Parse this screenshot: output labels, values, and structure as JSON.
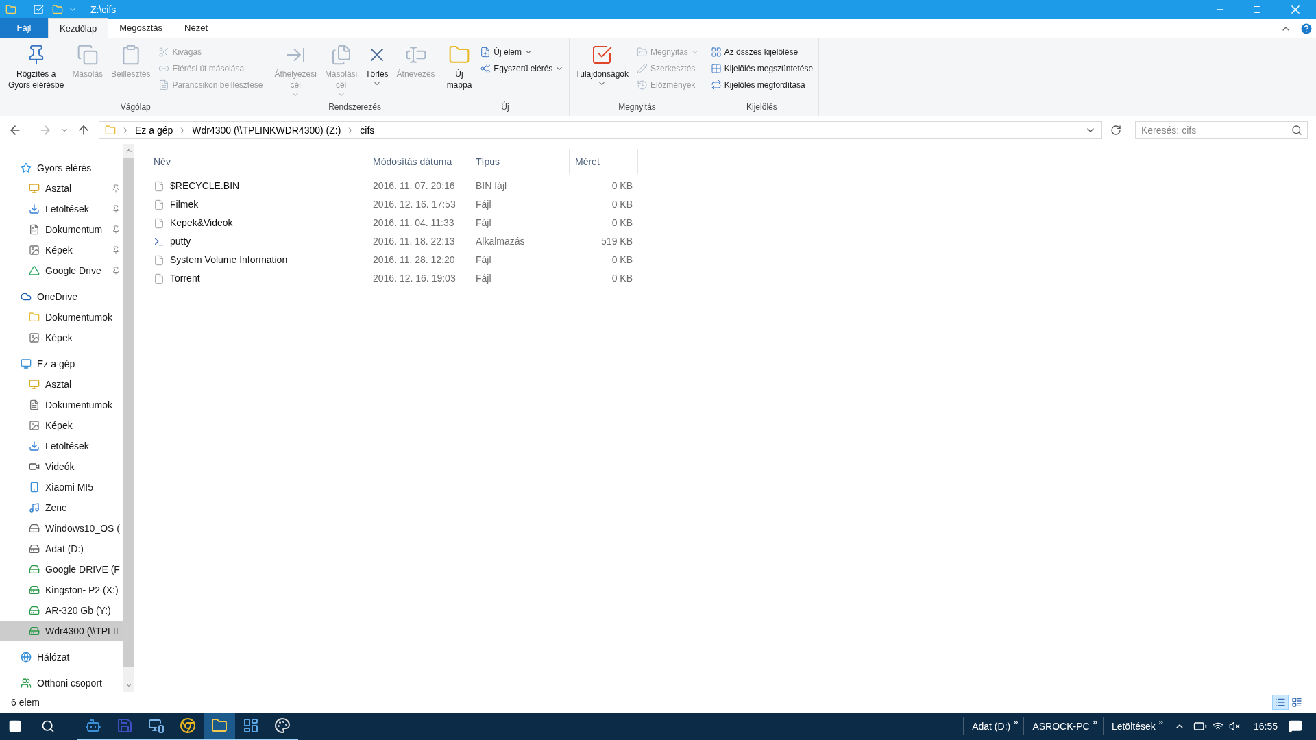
{
  "window": {
    "title": "Z:\\cifs"
  },
  "ribbon_tabs": [
    {
      "label": "Fájl",
      "kind": "file",
      "selected": false
    },
    {
      "label": "Kezdőlap",
      "kind": "tab",
      "selected": true
    },
    {
      "label": "Megosztás",
      "kind": "tab",
      "selected": false
    },
    {
      "label": "Nézet",
      "kind": "tab",
      "selected": false
    }
  ],
  "ribbon_groups": [
    {
      "label": "Vágólap",
      "commands": [
        {
          "label": "Rögzítés a\nGyors elérésbe",
          "kind": "large",
          "disabled": false,
          "dropdown": false
        },
        {
          "label": "Másolás",
          "kind": "large",
          "disabled": true,
          "dropdown": false
        },
        {
          "label": "Beillesztés",
          "kind": "large",
          "disabled": true,
          "dropdown": false
        },
        {
          "label": "Kivágás",
          "kind": "small",
          "disabled": true,
          "dropdown": false
        },
        {
          "label": "Elérési út másolása",
          "kind": "small",
          "disabled": true,
          "dropdown": false
        },
        {
          "label": "Parancsikon beillesztése",
          "kind": "small",
          "disabled": true,
          "dropdown": false
        }
      ]
    },
    {
      "label": "Rendszerezés",
      "commands": [
        {
          "label": "Áthelyezési\ncél",
          "kind": "large",
          "disabled": true,
          "dropdown": true
        },
        {
          "label": "Másolási\ncél",
          "kind": "large",
          "disabled": true,
          "dropdown": true
        },
        {
          "label": "Törlés",
          "kind": "large",
          "disabled": false,
          "dropdown": true
        },
        {
          "label": "Átnevezés",
          "kind": "large",
          "disabled": true,
          "dropdown": false
        }
      ]
    },
    {
      "label": "Új",
      "commands": [
        {
          "label": "Új\nmappa",
          "kind": "large",
          "disabled": false,
          "dropdown": false
        },
        {
          "label": "Új elem",
          "kind": "small",
          "disabled": false,
          "dropdown": true
        },
        {
          "label": "Egyszerű elérés",
          "kind": "small",
          "disabled": false,
          "dropdown": true
        }
      ]
    },
    {
      "label": "Megnyitás",
      "commands": [
        {
          "label": "Tulajdonságok",
          "kind": "large",
          "disabled": false,
          "dropdown": true
        },
        {
          "label": "Megnyitás",
          "kind": "small",
          "disabled": true,
          "dropdown": true
        },
        {
          "label": "Szerkesztés",
          "kind": "small",
          "disabled": true,
          "dropdown": false
        },
        {
          "label": "Előzmények",
          "kind": "small",
          "disabled": true,
          "dropdown": false
        }
      ]
    },
    {
      "label": "Kijelölés",
      "commands": [
        {
          "label": "Az összes kijelölése",
          "kind": "small",
          "disabled": false,
          "dropdown": false
        },
        {
          "label": "Kijelölés megszüntetése",
          "kind": "small",
          "disabled": false,
          "dropdown": false
        },
        {
          "label": "Kijelölés megfordítása",
          "kind": "small",
          "disabled": false,
          "dropdown": false
        }
      ]
    }
  ],
  "address_bar": {
    "crumbs": [
      "Ez a gép",
      "Wdr4300 (\\\\TPLINKWDR4300) (Z:)",
      "cifs"
    ]
  },
  "search": {
    "placeholder": "Keresés: cifs"
  },
  "nav_pane": {
    "items": [
      {
        "label": "Gyors elérés",
        "kind": "quick",
        "selected": false,
        "children": [
          {
            "label": "Asztal",
            "kind": "desktop",
            "pinned": true,
            "selected": false
          },
          {
            "label": "Letöltések",
            "kind": "downloads",
            "pinned": true,
            "selected": false
          },
          {
            "label": "Dokumentum",
            "kind": "documents",
            "pinned": true,
            "selected": false
          },
          {
            "label": "Képek",
            "kind": "pictures",
            "pinned": true,
            "selected": false
          },
          {
            "label": "Google Drive",
            "kind": "gdrive",
            "pinned": true,
            "selected": false
          }
        ]
      },
      {
        "label": "OneDrive",
        "kind": "cloud",
        "selected": false,
        "children": [
          {
            "label": "Dokumentumok",
            "kind": "folder",
            "pinned": false,
            "selected": false
          },
          {
            "label": "Képek",
            "kind": "pictures",
            "pinned": false,
            "selected": false
          }
        ]
      },
      {
        "label": "Ez a gép",
        "kind": "pc",
        "selected": false,
        "children": [
          {
            "label": "Asztal",
            "kind": "desktop",
            "pinned": false,
            "selected": false
          },
          {
            "label": "Dokumentumok",
            "kind": "documents",
            "pinned": false,
            "selected": false
          },
          {
            "label": "Képek",
            "kind": "pictures",
            "pinned": false,
            "selected": false
          },
          {
            "label": "Letöltések",
            "kind": "downloads",
            "pinned": false,
            "selected": false
          },
          {
            "label": "Videók",
            "kind": "videos",
            "pinned": false,
            "selected": false
          },
          {
            "label": "Xiaomi MI5",
            "kind": "device",
            "pinned": false,
            "selected": false
          },
          {
            "label": "Zene",
            "kind": "music",
            "pinned": false,
            "selected": false
          },
          {
            "label": "Windows10_OS (",
            "kind": "disk",
            "pinned": false,
            "selected": false
          },
          {
            "label": "Adat (D:)",
            "kind": "disk",
            "pinned": false,
            "selected": false
          },
          {
            "label": "Google DRIVE (F",
            "kind": "netdrive",
            "pinned": false,
            "selected": false
          },
          {
            "label": "Kingston- P2 (X:)",
            "kind": "netdrive",
            "pinned": false,
            "selected": false
          },
          {
            "label": "AR-320 Gb (Y:)",
            "kind": "netdrive",
            "pinned": false,
            "selected": false
          },
          {
            "label": "Wdr4300 (\\\\TPLII",
            "kind": "netdrive",
            "pinned": false,
            "selected": true
          }
        ]
      },
      {
        "label": "Hálózat",
        "kind": "network",
        "selected": false
      },
      {
        "label": "Otthoni csoport",
        "kind": "homegroup",
        "selected": false
      }
    ]
  },
  "file_list": {
    "columns": [
      "Név",
      "Módosítás dátuma",
      "Típus",
      "Méret"
    ],
    "rows": [
      {
        "name": "$RECYCLE.BIN",
        "date": "2016. 11. 07. 20:16",
        "type": "BIN fájl",
        "size": "0 KB",
        "kind": "file"
      },
      {
        "name": "Filmek",
        "date": "2016. 12. 16. 17:53",
        "type": "Fájl",
        "size": "0 KB",
        "kind": "file"
      },
      {
        "name": "Kepek&Videok",
        "date": "2016. 11. 04. 11:33",
        "type": "Fájl",
        "size": "0 KB",
        "kind": "file"
      },
      {
        "name": "putty",
        "date": "2016. 11. 18. 22:13",
        "type": "Alkalmazás",
        "size": "519 KB",
        "kind": "app"
      },
      {
        "name": "System Volume Information",
        "date": "2016. 11. 28. 12:20",
        "type": "Fájl",
        "size": "0 KB",
        "kind": "file"
      },
      {
        "name": "Torrent",
        "date": "2016. 12. 16. 19:03",
        "type": "Fájl",
        "size": "0 KB",
        "kind": "file"
      }
    ]
  },
  "status_bar": {
    "count": "6 elem",
    "views": [
      {
        "kind": "details",
        "selected": true
      },
      {
        "kind": "tiles",
        "selected": false
      }
    ]
  },
  "taskbar": {
    "apps": [
      {
        "kind": "robot",
        "running": true,
        "selected": false
      },
      {
        "kind": "floppy",
        "running": true,
        "selected": false
      },
      {
        "kind": "remote",
        "running": true,
        "selected": false
      },
      {
        "kind": "browser",
        "running": true,
        "selected": false
      },
      {
        "kind": "explorer",
        "running": true,
        "selected": true
      },
      {
        "kind": "panel",
        "running": true,
        "selected": false
      },
      {
        "kind": "paint",
        "running": true,
        "selected": false
      }
    ],
    "toolbars": [
      {
        "label": "Adat (D:)",
        "chevron": "»"
      },
      {
        "label": "ASROCK-PC",
        "chevron": "»"
      },
      {
        "label": "Letöltések",
        "chevron": "»"
      }
    ],
    "clock": "16:55"
  }
}
